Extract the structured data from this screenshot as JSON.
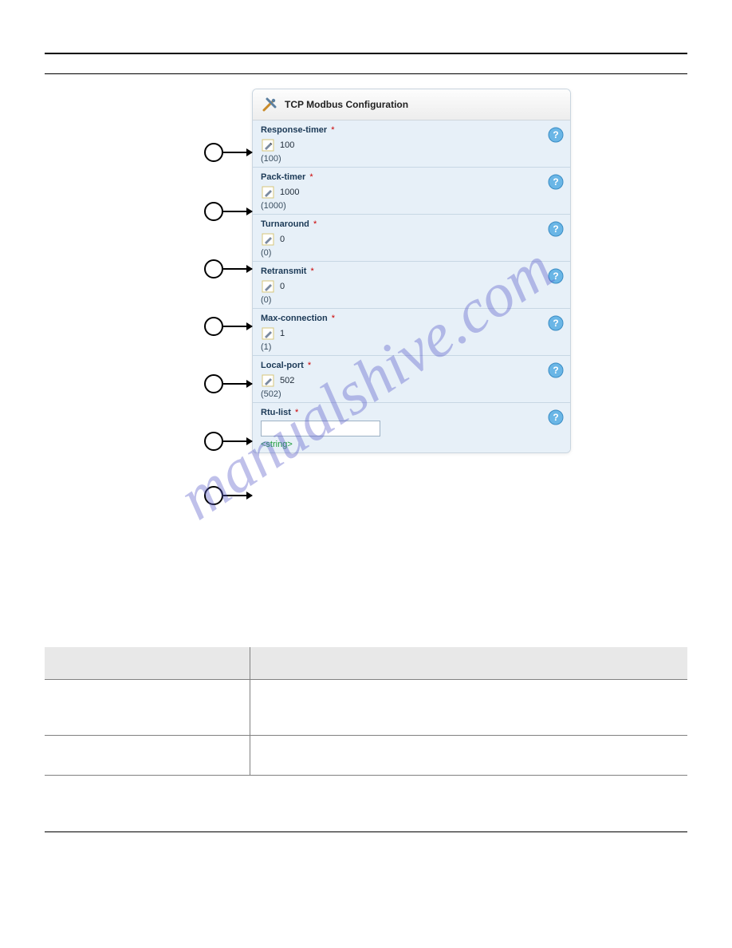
{
  "watermark": "manualshive.com",
  "panel": {
    "title": "TCP Modbus Configuration"
  },
  "fields": [
    {
      "label": "Response-timer",
      "value": "100",
      "default": "(100)"
    },
    {
      "label": "Pack-timer",
      "value": "1000",
      "default": "(1000)"
    },
    {
      "label": "Turnaround",
      "value": "0",
      "default": "(0)"
    },
    {
      "label": "Retransmit",
      "value": "0",
      "default": "(0)"
    },
    {
      "label": "Max-connection",
      "value": "1",
      "default": "(1)"
    },
    {
      "label": "Local-port",
      "value": "502",
      "default": "(502)"
    },
    {
      "label": "Rtu-list",
      "hint": "<string>"
    }
  ],
  "table": {
    "header_left": " ",
    "header_right": " ",
    "rows": [
      {
        "left": " ",
        "right": " "
      },
      {
        "left": " ",
        "right": " "
      }
    ]
  }
}
